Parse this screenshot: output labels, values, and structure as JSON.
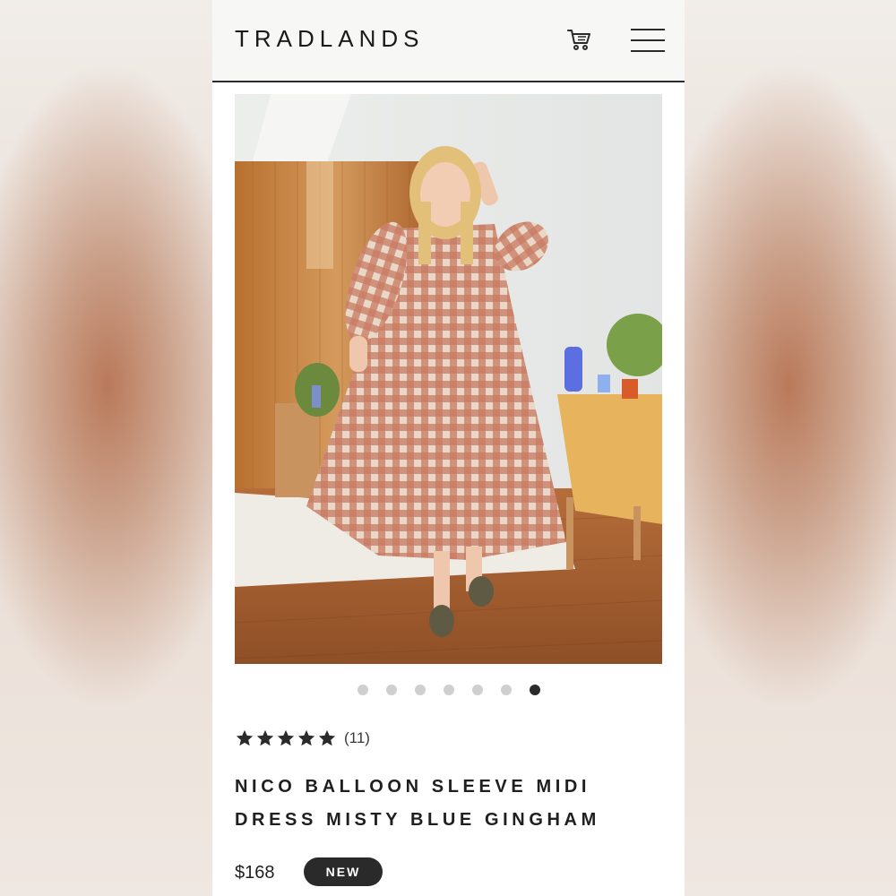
{
  "header": {
    "logo": "TRADLANDS",
    "cart_icon": "shopping-cart-icon",
    "menu_icon": "hamburger-menu-icon"
  },
  "gallery": {
    "image_count": 7,
    "active_index": 6
  },
  "product": {
    "rating_stars": 5,
    "review_count": "(11)",
    "title_line1": "NICO BALLOON SLEEVE MIDI",
    "title_line2": "DRESS MISTY BLUE GINGHAM",
    "price": "$168",
    "badge": "NEW"
  },
  "colors": {
    "text": "#1f1f1f",
    "badge_bg": "#2a2a2a",
    "dot_active": "#2b2b2b",
    "dot_inactive": "#cfcfcf"
  }
}
